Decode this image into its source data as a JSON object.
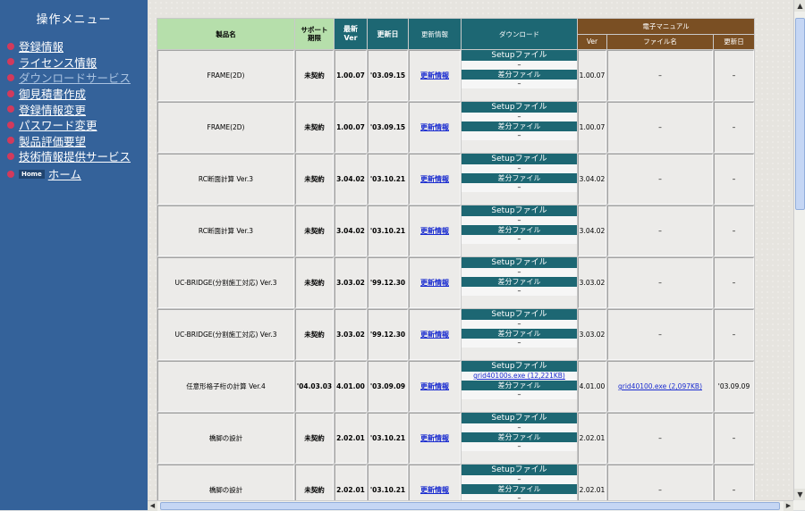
{
  "sidebar": {
    "title": "操作メニュー",
    "items": [
      {
        "label": "登録情報",
        "dim": false
      },
      {
        "label": "ライセンス情報",
        "dim": false
      },
      {
        "label": "ダウンロードサービス",
        "dim": true
      },
      {
        "label": "御見積書作成",
        "dim": false
      },
      {
        "label": "登録情報変更",
        "dim": false
      },
      {
        "label": "パスワード変更",
        "dim": false
      },
      {
        "label": "製品評価要望",
        "dim": false
      },
      {
        "label": "技術情報提供サービス",
        "dim": false
      }
    ],
    "home_badge": "Home",
    "home_label": "ホーム"
  },
  "table": {
    "headers": {
      "product": "製品名",
      "support": "サポート\n期限",
      "latest_ver": "最新\nVer",
      "updated": "更新日",
      "update_info": "更新情報",
      "download": "ダウンロード",
      "manual": "電子マニュアル",
      "manual_ver": "Ver",
      "manual_file": "ファイル名",
      "manual_updated": "更新日"
    },
    "setup_label": "Setupファイル",
    "diff_label": "差分ファイル",
    "dash": "–",
    "rows": [
      {
        "name": "FRAME(2D)",
        "support": "未契約",
        "ver": "1.00.07",
        "date": "'03.09.15",
        "info": "更新情報",
        "setup_file": "–",
        "diff_file": "–",
        "m_ver": "1.00.07",
        "m_file": "–",
        "m_date": "–"
      },
      {
        "name": "FRAME(2D)",
        "support": "未契約",
        "ver": "1.00.07",
        "date": "'03.09.15",
        "info": "更新情報",
        "setup_file": "–",
        "diff_file": "–",
        "m_ver": "1.00.07",
        "m_file": "–",
        "m_date": "–"
      },
      {
        "name": "RC断面計算 Ver.3",
        "support": "未契約",
        "ver": "3.04.02",
        "date": "'03.10.21",
        "info": "更新情報",
        "setup_file": "–",
        "diff_file": "–",
        "m_ver": "3.04.02",
        "m_file": "–",
        "m_date": "–"
      },
      {
        "name": "RC断面計算 Ver.3",
        "support": "未契約",
        "ver": "3.04.02",
        "date": "'03.10.21",
        "info": "更新情報",
        "setup_file": "–",
        "diff_file": "–",
        "m_ver": "3.04.02",
        "m_file": "–",
        "m_date": "–"
      },
      {
        "name": "UC-BRIDGE(分割施工対応) Ver.3",
        "support": "未契約",
        "ver": "3.03.02",
        "date": "'99.12.30",
        "info": "更新情報",
        "setup_file": "–",
        "diff_file": "–",
        "m_ver": "3.03.02",
        "m_file": "–",
        "m_date": "–"
      },
      {
        "name": "UC-BRIDGE(分割施工対応) Ver.3",
        "support": "未契約",
        "ver": "3.03.02",
        "date": "'99.12.30",
        "info": "更新情報",
        "setup_file": "–",
        "diff_file": "–",
        "m_ver": "3.03.02",
        "m_file": "–",
        "m_date": "–"
      },
      {
        "name": "任意形格子桁の計算 Ver.4",
        "support": "'04.03.03",
        "ver": "4.01.00",
        "date": "'03.09.09",
        "info": "更新情報",
        "setup_file": "grid40100s.exe (12,221KB)",
        "setup_link": true,
        "diff_file": "–",
        "m_ver": "4.01.00",
        "m_file": "grid40100.exe (2,097KB)",
        "m_link": true,
        "m_date": "'03.09.09"
      },
      {
        "name": "橋脚の設計",
        "support": "未契約",
        "ver": "2.02.01",
        "date": "'03.10.21",
        "info": "更新情報",
        "setup_file": "–",
        "diff_file": "–",
        "m_ver": "2.02.01",
        "m_file": "–",
        "m_date": "–"
      },
      {
        "name": "橋脚の設計",
        "support": "未契約",
        "ver": "2.02.01",
        "date": "'03.10.21",
        "info": "更新情報",
        "setup_file": "–",
        "diff_file": "–",
        "m_ver": "2.02.01",
        "m_file": "–",
        "m_date": "–"
      }
    ]
  },
  "scrollbar": {
    "up_icon": "▲",
    "down_icon": "▼",
    "left_icon": "◀",
    "right_icon": "▶"
  },
  "colors": {
    "sidebar_bg": "#34629a",
    "bullet": "#d23a5c",
    "header_green": "#b6dfab",
    "download_teal": "#1d6773",
    "manual_brown": "#7a4f23",
    "link": "#1a2cd0"
  }
}
